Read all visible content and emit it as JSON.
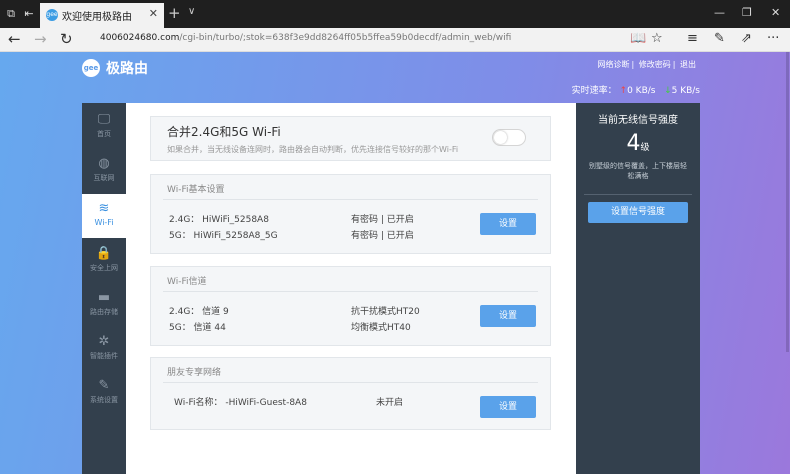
{
  "browser": {
    "tab_title": "欢迎使用极路由",
    "tab_close": "✕",
    "new_tab": "+",
    "tab_menu": "∨",
    "url_host": "4006024680.com",
    "url_path": "/cgi-bin/turbo/;stok=638f3e9dd8264ff05b5ffea59b0decdf/admin_web/wifi",
    "win_minimize": "—",
    "win_restore": "❐",
    "win_close": "✕",
    "back": "←",
    "forward": "→",
    "refresh": "↻",
    "tool_reading": "📖",
    "tool_favorite": "☆",
    "tool_hub": "≡",
    "tool_note": "✎",
    "tool_share": "⇗",
    "tool_more": "···"
  },
  "header": {
    "logo_mark": "gee",
    "logo_text": "极路由",
    "links": [
      "网络诊断",
      "修改密码",
      "退出"
    ],
    "speed_label": "实时速率：",
    "speed_up": "0 KB/s",
    "speed_down": "5 KB/s"
  },
  "sidebar": {
    "items": [
      {
        "icon": "🖵",
        "label": "首页"
      },
      {
        "icon": "◍",
        "label": "互联网"
      },
      {
        "icon": "≋",
        "label": "Wi-Fi"
      },
      {
        "icon": "🔒",
        "label": "安全上网"
      },
      {
        "icon": "▬",
        "label": "路由存储"
      },
      {
        "icon": "✲",
        "label": "智能插件"
      },
      {
        "icon": "✎",
        "label": "系统设置"
      }
    ]
  },
  "merge": {
    "title": "合并2.4G和5G Wi-Fi",
    "desc": "如果合并，当无线设备连网时，路由器会自动判断，优先连接信号较好的那个Wi-Fi",
    "enabled": false
  },
  "basic": {
    "title": "Wi-Fi基本设置",
    "row1_left": "2.4G： HiWiFi_5258A8",
    "row1_right": "有密码 | 已开启",
    "row2_left": "5G： HiWiFi_5258A8_5G",
    "row2_right": "有密码 | 已开启",
    "button": "设置"
  },
  "channel": {
    "title": "Wi-Fi信道",
    "row1_left": "2.4G： 信道 9",
    "row1_right": "抗干扰模式HT20",
    "row2_left": "5G： 信道 44",
    "row2_right": "均衡模式HT40",
    "button": "设置"
  },
  "guest": {
    "title": "朋友专享网络",
    "row1_left": "Wi-Fi名称： -HiWiFi-Guest-8A8",
    "row1_right": "未开启",
    "button": "设置"
  },
  "signal": {
    "title": "当前无线信号强度",
    "level": "4",
    "unit": "级",
    "desc": "别墅级的信号覆盖，上下楼层轻松满格",
    "button": "设置信号强度"
  }
}
